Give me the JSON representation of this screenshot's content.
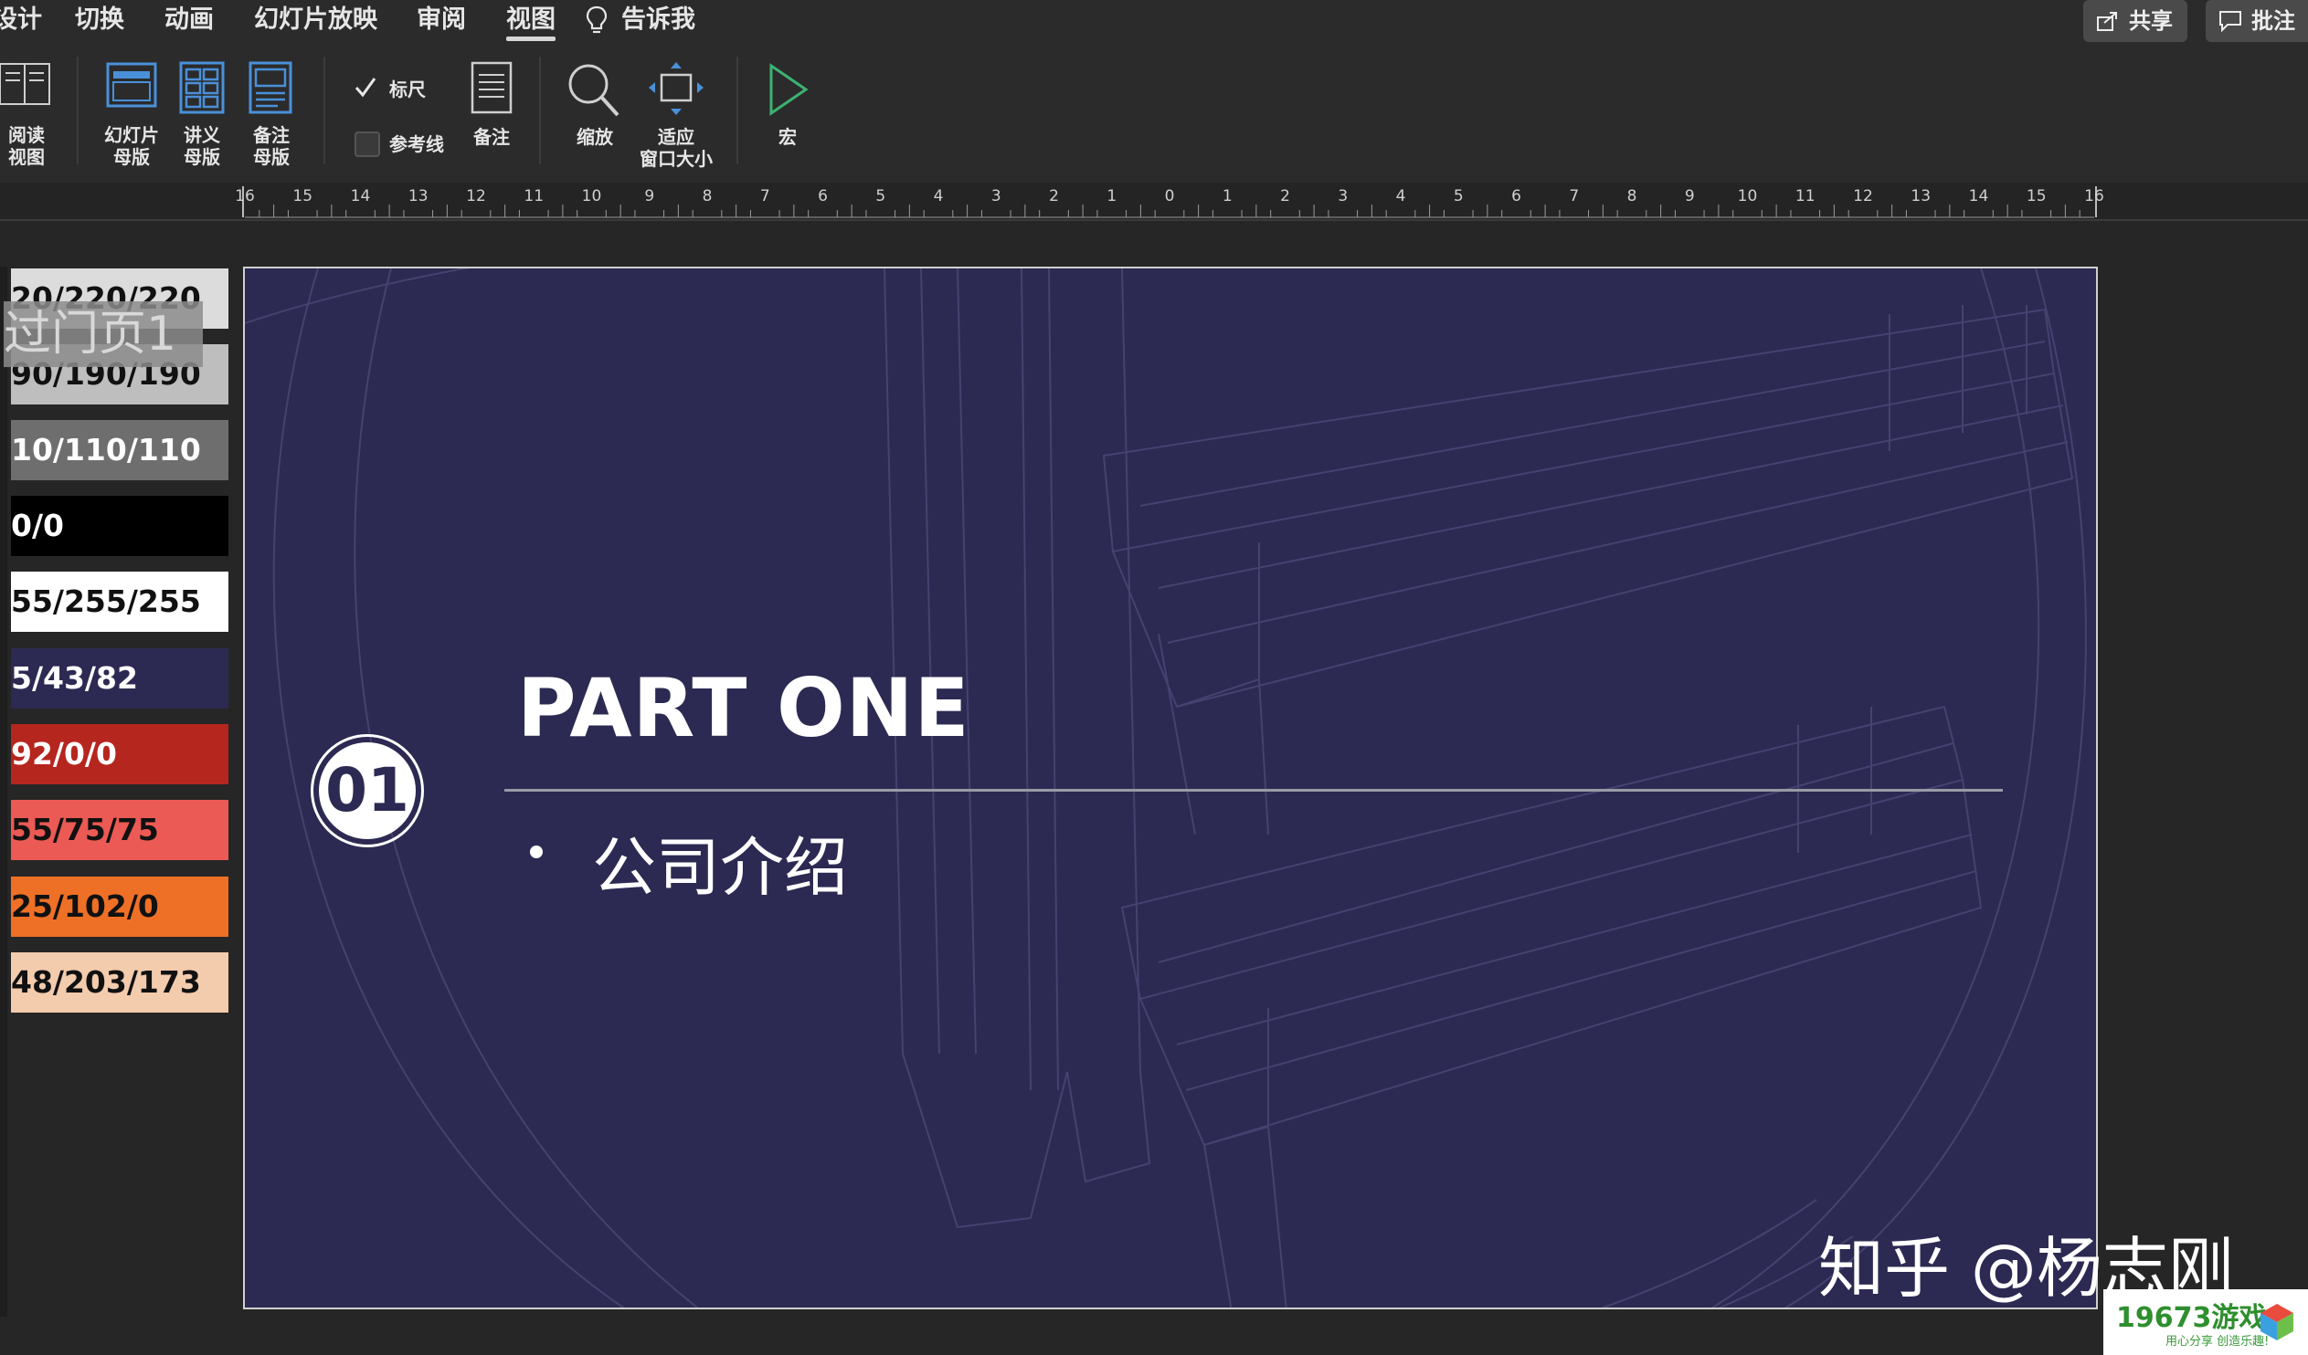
{
  "menu": {
    "items": [
      {
        "label": "设计"
      },
      {
        "label": "切换"
      },
      {
        "label": "动画"
      },
      {
        "label": "幻灯片放映"
      },
      {
        "label": "审阅"
      },
      {
        "label": "视图",
        "active": true
      },
      {
        "label": "告诉我"
      }
    ],
    "share_label": "共享",
    "comments_label": "批注"
  },
  "ribbon": {
    "reading_view": "阅读\n视图",
    "slide_master": "幻灯片\n母版",
    "handout_master": "讲义\n母版",
    "notes_master": "备注\n母版",
    "ruler": {
      "label": "标尺",
      "checked": true
    },
    "guides": {
      "label": "参考线",
      "checked": false
    },
    "notes": "备注",
    "zoom": "缩放",
    "fit_window": "适应\n窗口大小",
    "macro": "宏"
  },
  "ruler": {
    "labels": [
      "16",
      "15",
      "14",
      "13",
      "12",
      "11",
      "10",
      "9",
      "8",
      "7",
      "6",
      "5",
      "4",
      "3",
      "2",
      "1",
      "0",
      "1",
      "2",
      "3",
      "4",
      "5",
      "6",
      "7",
      "8",
      "9",
      "10",
      "11",
      "12",
      "13",
      "14",
      "15",
      "16"
    ]
  },
  "thumbnails": {
    "swatches": [
      {
        "text": "20/220/220",
        "bg": "#dcdcdc",
        "fg": "#111111"
      },
      {
        "text": "90/190/190",
        "bg": "#bebebe",
        "fg": "#111111"
      },
      {
        "text": "10/110/110",
        "bg": "#6e6e6e",
        "fg": "#ffffff"
      },
      {
        "text": "0/0",
        "bg": "#000000",
        "fg": "#ffffff"
      },
      {
        "text": "55/255/255",
        "bg": "#ffffff",
        "fg": "#111111"
      },
      {
        "text": "5/43/82",
        "bg": "#2c2a52",
        "fg": "#ffffff"
      },
      {
        "text": "92/0/0",
        "bg": "#b5261e",
        "fg": "#ffffff"
      },
      {
        "text": "55/75/75",
        "bg": "#eb5a54",
        "fg": "#111111"
      },
      {
        "text": "25/102/0",
        "bg": "#ee7027",
        "fg": "#111111"
      },
      {
        "text": "48/203/173",
        "bg": "#f3cbad",
        "fg": "#111111"
      }
    ],
    "transition_tag": "过门页1"
  },
  "slide": {
    "badge_number": "01",
    "title": "PART ONE",
    "bullet": "公司介绍",
    "background": "#2c2a52"
  },
  "watermark": "知乎 @杨志刚",
  "site_logo": {
    "main": "19673游戏",
    "tagline": "用心分享 创造乐趣!"
  }
}
